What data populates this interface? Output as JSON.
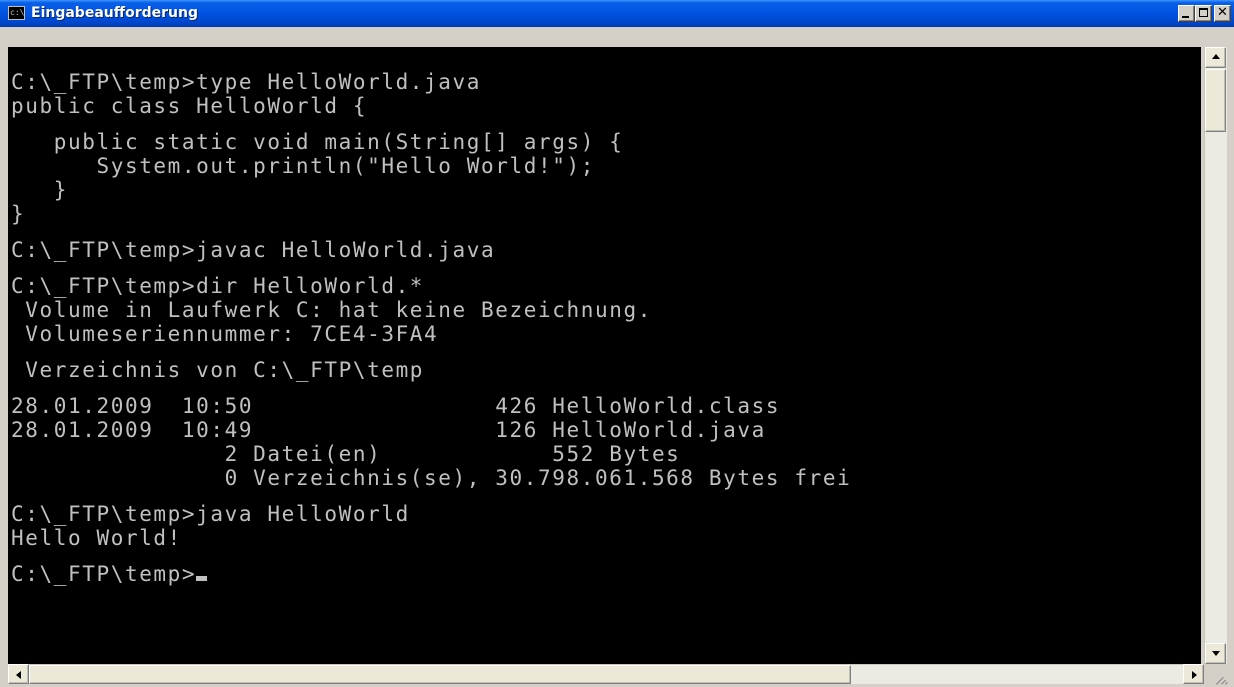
{
  "window": {
    "title": "Eingabeaufforderung",
    "icon": "cmd-icon",
    "icon_glyph": "c:\\",
    "buttons": {
      "minimize_icon": "minimize-icon",
      "maximize_icon": "maximize-icon",
      "close_icon": "close-icon",
      "close_glyph": "✕"
    }
  },
  "console": {
    "background": "#000000",
    "foreground": "#c0c0c0",
    "lines": [
      "C:\\_FTP\\temp>type HelloWorld.java",
      "public class HelloWorld {",
      "",
      "   public static void main(String[] args) {",
      "      System.out.println(\"Hello World!\");",
      "   }",
      "}",
      "",
      "C:\\_FTP\\temp>javac HelloWorld.java",
      "",
      "C:\\_FTP\\temp>dir HelloWorld.*",
      " Volume in Laufwerk C: hat keine Bezeichnung.",
      " Volumeseriennummer: 7CE4-3FA4",
      "",
      " Verzeichnis von C:\\_FTP\\temp",
      "",
      "28.01.2009  10:50                 426 HelloWorld.class",
      "28.01.2009  10:49                 126 HelloWorld.java",
      "               2 Datei(en)            552 Bytes",
      "               0 Verzeichnis(se), 30.798.061.568 Bytes frei",
      "",
      "C:\\_FTP\\temp>java HelloWorld",
      "Hello World!",
      ""
    ],
    "prompt": "C:\\_FTP\\temp>"
  },
  "scrollbars": {
    "vertical": {
      "position": 0.0
    },
    "horizontal": {
      "position": 0.0
    }
  }
}
